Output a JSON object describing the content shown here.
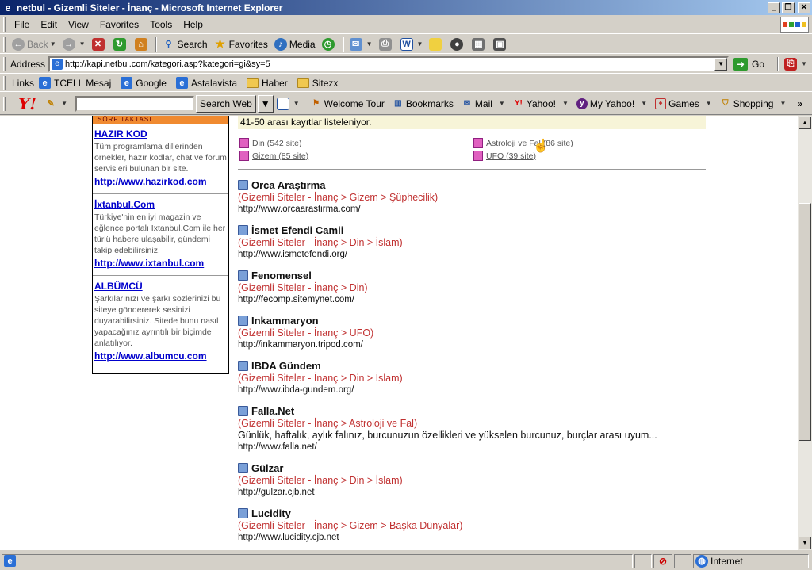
{
  "window": {
    "title": "netbul - Gizemli Siteler - İnanç - Microsoft Internet Explorer",
    "app_icon": "ie-icon",
    "controls": [
      "minimize",
      "maximize",
      "close"
    ]
  },
  "menu": [
    "File",
    "Edit",
    "View",
    "Favorites",
    "Tools",
    "Help"
  ],
  "toolbar": {
    "back": "Back",
    "search": "Search",
    "favorites": "Favorites",
    "media": "Media"
  },
  "address": {
    "label": "Address",
    "url": "http://kapi.netbul.com/kategori.asp?kategori=gi&sy=5",
    "go": "Go"
  },
  "links": {
    "label": "Links",
    "items": [
      "TCELL Mesaj",
      "Google",
      "Astalavista",
      "Haber",
      "Sitezx"
    ]
  },
  "yahoo": {
    "search_button": "Search Web",
    "items": [
      "Welcome Tour",
      "Bookmarks",
      "Mail",
      "Yahoo!",
      "My Yahoo!",
      "Games",
      "Shopping"
    ],
    "overflow": "»"
  },
  "sidebar": {
    "header": "SÖRF TAKTASI",
    "blocks": [
      {
        "title": "HAZIR KOD",
        "desc": "Tüm programlama dillerinden örnekler, hazır kodlar, chat ve forum servisleri bulunan bir site.",
        "url": "http://www.hazirkod.com"
      },
      {
        "title": "İxtanbul.Com",
        "desc": "Türkiye'nin en iyi magazin ve eğlence portalı İxtanbul.Com ile her türlü habere ulaşabilir, gündemi takip edebilirsiniz.",
        "url": "http://www.ixtanbul.com"
      },
      {
        "title": "ALBÜMCÜ",
        "desc": "Şarkılarınızı ve şarkı sözlerinizi bu siteye göndererek sesinizi duyarabilirsiniz. Sitede bunu nasıl yapacağınız ayrıntılı bir biçimde anlatılıyor.",
        "url": "http://www.albumcu.com"
      }
    ]
  },
  "main": {
    "notice": "41-50 arası kayıtlar listeleniyor.",
    "categories": [
      "Din (542 site)",
      "Astroloji ve Fal (86 site)",
      "Gizem (85 site)",
      "UFO (39 site)"
    ],
    "entries": [
      {
        "title": "Orca Araştırma",
        "path": "(Gizemli Siteler - İnanç > Gizem > Şüphecilik)",
        "desc": "",
        "url": "http://www.orcaarastirma.com/"
      },
      {
        "title": "İsmet Efendi Camii",
        "path": "(Gizemli Siteler - İnanç > Din > İslam)",
        "desc": "",
        "url": "http://www.ismetefendi.org/"
      },
      {
        "title": "Fenomensel",
        "path": "(Gizemli Siteler - İnanç > Din)",
        "desc": "",
        "url": "http://fecomp.sitemynet.com/"
      },
      {
        "title": "Inkammaryon",
        "path": "(Gizemli Siteler - İnanç > UFO)",
        "desc": "",
        "url": "http://inkammaryon.tripod.com/"
      },
      {
        "title": "IBDA Gündem",
        "path": "(Gizemli Siteler - İnanç > Din > İslam)",
        "desc": "",
        "url": "http://www.ibda-gundem.org/"
      },
      {
        "title": "Falla.Net",
        "path": "(Gizemli Siteler - İnanç > Astroloji ve Fal)",
        "desc": "Günlük, haftalık, aylık falınız, burcunuzun özellikleri ve yükselen burcunuz, burçlar arası uyum...",
        "url": "http://www.falla.net/"
      },
      {
        "title": "Gülzar",
        "path": "(Gizemli Siteler - İnanç > Din > İslam)",
        "desc": "",
        "url": "http://gulzar.cjb.net"
      },
      {
        "title": "Lucidity",
        "path": "(Gizemli Siteler - İnanç > Gizem > Başka Dünyalar)",
        "desc": "",
        "url": "http://www.lucidity.cjb.net"
      }
    ]
  },
  "status": {
    "zone": "Internet"
  }
}
